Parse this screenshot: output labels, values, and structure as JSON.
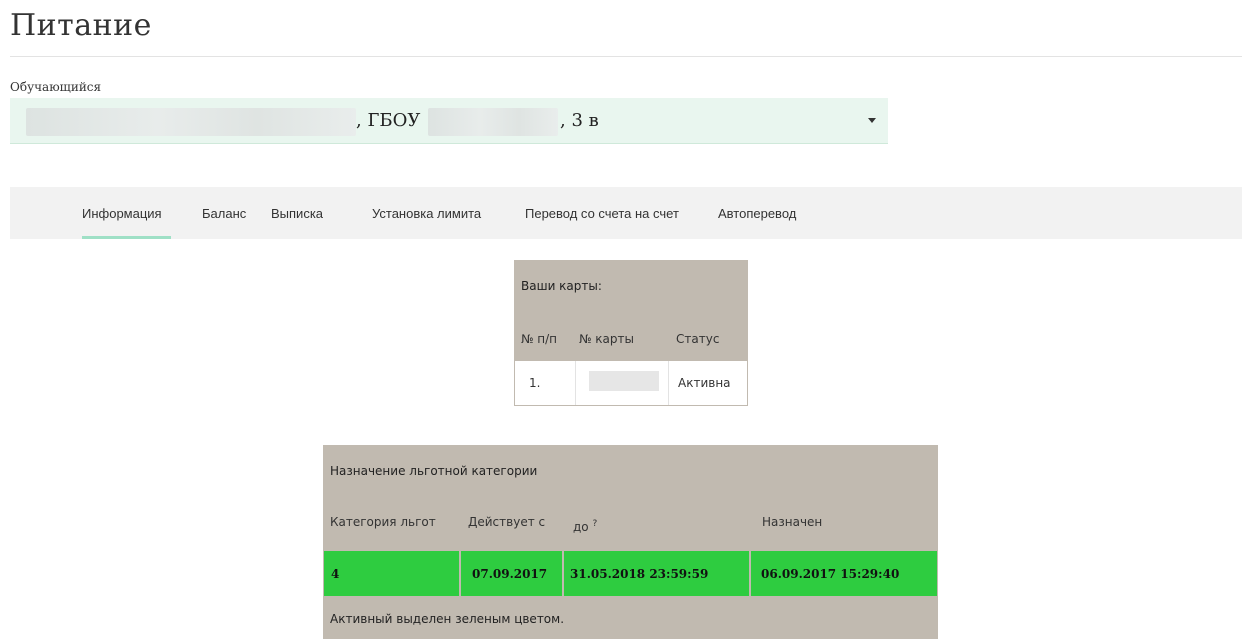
{
  "page": {
    "title": "Питание"
  },
  "student": {
    "label": "Обучающийся",
    "school_text": ", ГБОУ",
    "class_text": ", 3 в"
  },
  "tabs": [
    {
      "label": "Информация",
      "active": true
    },
    {
      "label": "Баланс"
    },
    {
      "label": "Выписка"
    },
    {
      "label": "Установка лимита"
    },
    {
      "label": "Перевод со счета на счет"
    },
    {
      "label": "Автоперевод"
    }
  ],
  "cards": {
    "title": "Ваши карты:",
    "headers": [
      "№ п/п",
      "№ карты",
      "Статус"
    ],
    "rows": [
      {
        "num": "1.",
        "status": "Активна"
      }
    ]
  },
  "benefit": {
    "title": "Назначение льготной категории",
    "headers": [
      "Категория льгот",
      "Действует с",
      "до",
      "?",
      "Назначен"
    ],
    "row": [
      "4",
      "07.09.2017",
      "31.05.2018 23:59:59",
      "06.09.2017 15:29:40"
    ],
    "note": "Активный выделен зеленым цветом.",
    "active_color": "#2ecc40"
  },
  "colors": {
    "select_bg": "#e9f6ef",
    "tab_bar_bg": "#f2f2f2",
    "tab_active_underline": "#9fe0c6",
    "table_bg": "#c1bab0"
  },
  "icons": {
    "select_caret": "caret-down-icon"
  }
}
